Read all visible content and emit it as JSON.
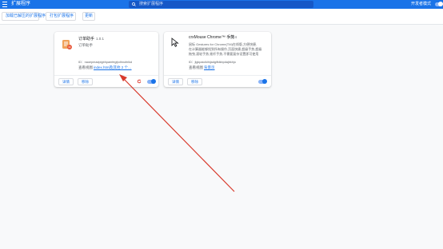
{
  "header": {
    "title": "扩展程序",
    "search_placeholder": "搜索扩展程序",
    "dev_mode_label": "开发者模式"
  },
  "toolbar": {
    "load_unpacked": "加载已解压的扩展程序",
    "pack_extension": "打包扩展程序",
    "update": "更新"
  },
  "extensions": [
    {
      "name": "订单助手",
      "version": "1.0.1",
      "description": "订单助手",
      "id_line": "ID：naoepmadplgbhpamfegfpdhnofnlkd",
      "view_label": "查看视图",
      "view_link": "index.html",
      "view_extra": "及其他 2 个…",
      "details_label": "详情",
      "remove_label": "移除",
      "enabled": true
    },
    {
      "name": "crxMouse Chrome™ 手势",
      "version": "4.4.4",
      "desc_lines": [
        "鼠标 Gestures for Chrome(TM)在线版,方便快捷,",
        "在计算器能够找到所有操作,页面快捷,超级手势,超级",
        "拖曳,滚轮手势,摇杆手势,不需要复杂设置即可使用"
      ],
      "id_line": "ID：jlgkpaicikihijadgifklkbpdajbkhjo",
      "view_label": "查看视图",
      "view_link": "背景页",
      "details_label": "详情",
      "remove_label": "移除",
      "enabled": true
    }
  ],
  "icons": {
    "menu": "menu-icon",
    "search": "search-icon",
    "reload": "reload-icon",
    "error": "error-icon",
    "ext1": "order-assistant-icon",
    "ext2": "mouse-cursor-icon"
  },
  "colors": {
    "accent": "#1a73e8",
    "annotation_arrow": "#d83a2c",
    "ext1_icon": "#f0a25a"
  }
}
